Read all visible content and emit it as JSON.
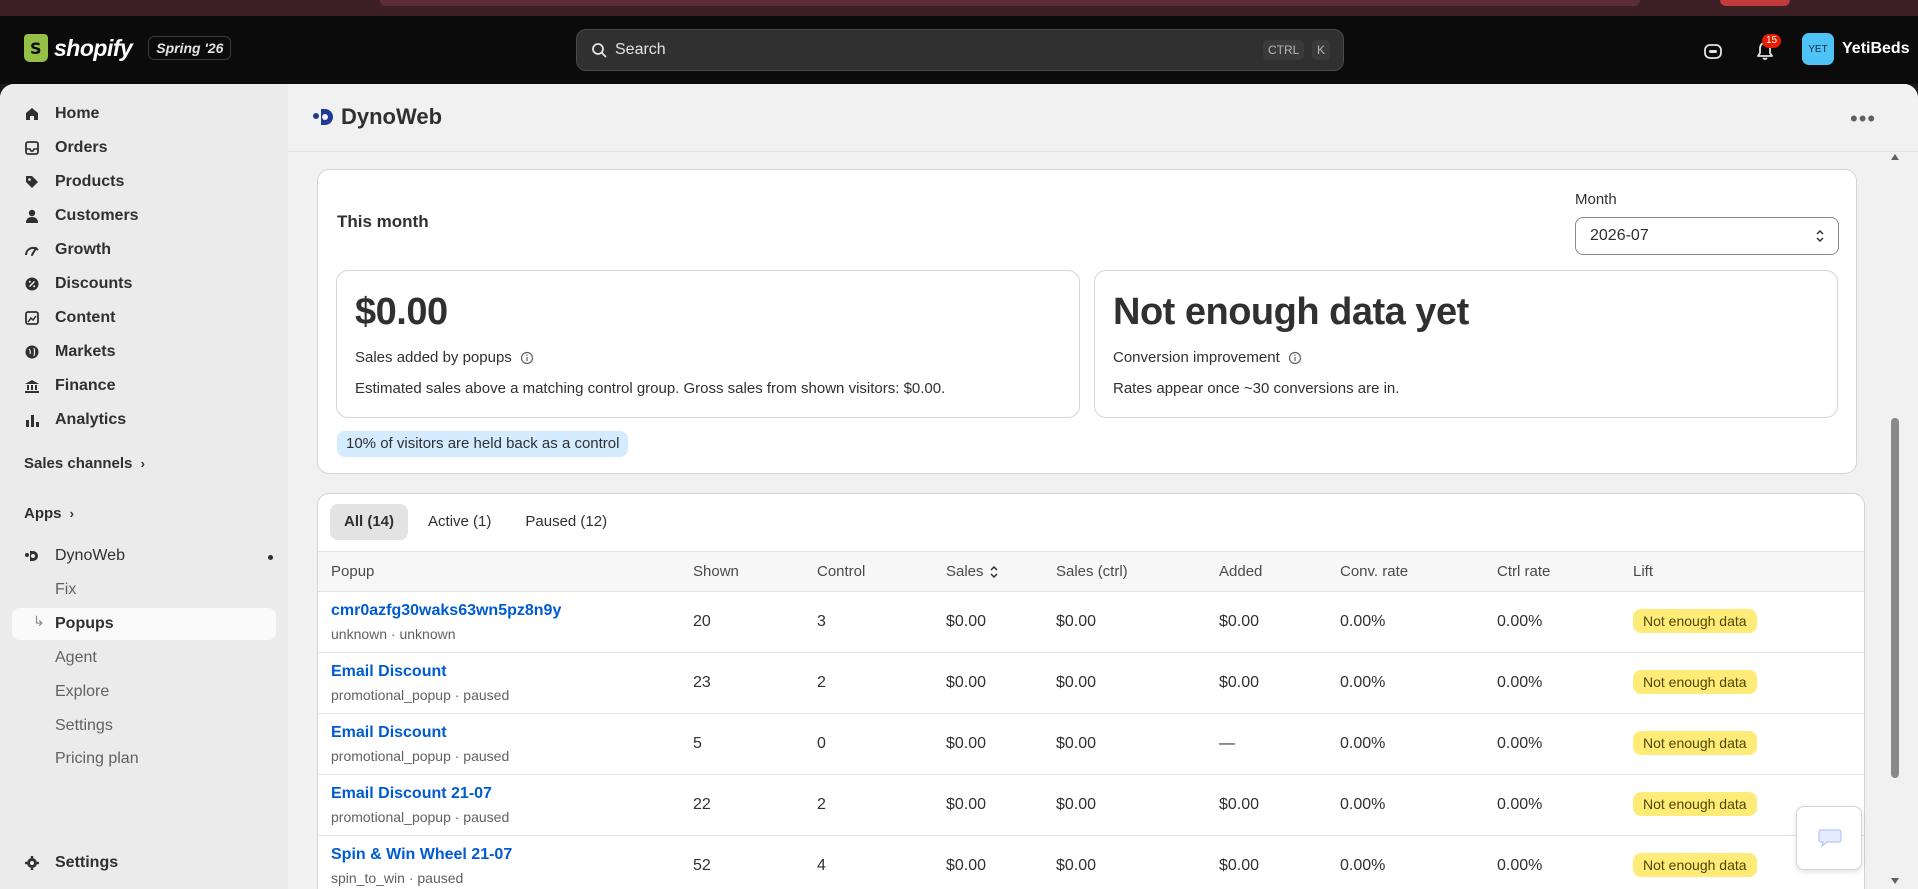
{
  "header": {
    "brand": "shopify",
    "edition": "Spring '26",
    "search_placeholder": "Search",
    "kbd_ctrl": "CTRL",
    "kbd_k": "K",
    "notification_count": "15",
    "avatar_initials": "YET",
    "store_name": "YetiBeds"
  },
  "sidebar": {
    "items": [
      {
        "label": "Home",
        "icon": "home-icon"
      },
      {
        "label": "Orders",
        "icon": "orders-icon"
      },
      {
        "label": "Products",
        "icon": "tag-icon"
      },
      {
        "label": "Customers",
        "icon": "person-icon"
      },
      {
        "label": "Growth",
        "icon": "growth-icon"
      },
      {
        "label": "Discounts",
        "icon": "discount-icon"
      },
      {
        "label": "Content",
        "icon": "image-icon"
      },
      {
        "label": "Markets",
        "icon": "globe-icon"
      },
      {
        "label": "Finance",
        "icon": "bank-icon"
      },
      {
        "label": "Analytics",
        "icon": "chart-icon"
      }
    ],
    "sales_channels": "Sales channels",
    "apps": "Apps",
    "app_name": "DynoWeb",
    "app_subitems": [
      "Fix",
      "Popups",
      "Agent",
      "Explore",
      "Settings",
      "Pricing plan"
    ],
    "settings": "Settings"
  },
  "app": {
    "title": "DynoWeb"
  },
  "summary": {
    "title": "This month",
    "month_label": "Month",
    "month_value": "2026-07",
    "sales_value": "$0.00",
    "sales_label": "Sales added by popups",
    "sales_desc": "Estimated sales above a matching control group. Gross sales from shown visitors: $0.00.",
    "conv_value": "Not enough data yet",
    "conv_label": "Conversion improvement",
    "conv_desc": "Rates appear once ~30 conversions are in.",
    "control_note": "10% of visitors are held back as a control"
  },
  "tabs": [
    "All (14)",
    "Active (1)",
    "Paused (12)"
  ],
  "table": {
    "columns": [
      "Popup",
      "Shown",
      "Control",
      "Sales",
      "Sales (ctrl)",
      "Added",
      "Conv. rate",
      "Ctrl rate",
      "Lift"
    ],
    "rows": [
      {
        "name": "cmr0azfg30waks63wn5pz8n9y",
        "meta": "unknown · unknown",
        "shown": "20",
        "control": "3",
        "sales": "$0.00",
        "sales_ctrl": "$0.00",
        "added": "$0.00",
        "conv": "0.00%",
        "ctrl_rate": "0.00%",
        "lift": "Not enough data"
      },
      {
        "name": "Email Discount",
        "meta": "promotional_popup · paused",
        "shown": "23",
        "control": "2",
        "sales": "$0.00",
        "sales_ctrl": "$0.00",
        "added": "$0.00",
        "conv": "0.00%",
        "ctrl_rate": "0.00%",
        "lift": "Not enough data"
      },
      {
        "name": "Email Discount",
        "meta": "promotional_popup · paused",
        "shown": "5",
        "control": "0",
        "sales": "$0.00",
        "sales_ctrl": "$0.00",
        "added": "—",
        "conv": "0.00%",
        "ctrl_rate": "0.00%",
        "lift": "Not enough data"
      },
      {
        "name": "Email Discount 21-07",
        "meta": "promotional_popup · paused",
        "shown": "22",
        "control": "2",
        "sales": "$0.00",
        "sales_ctrl": "$0.00",
        "added": "$0.00",
        "conv": "0.00%",
        "ctrl_rate": "0.00%",
        "lift": "Not enough data"
      },
      {
        "name": "Spin & Win Wheel 21-07",
        "meta": "spin_to_win · paused",
        "shown": "52",
        "control": "4",
        "sales": "$0.00",
        "sales_ctrl": "$0.00",
        "added": "$0.00",
        "conv": "0.00%",
        "ctrl_rate": "0.00%",
        "lift": "Not enough data"
      }
    ]
  },
  "colors": {
    "link": "#005bd3",
    "lift_badge": "#ffeb78",
    "control_badge": "#d5ebff",
    "brand_green": "#95bf47"
  }
}
